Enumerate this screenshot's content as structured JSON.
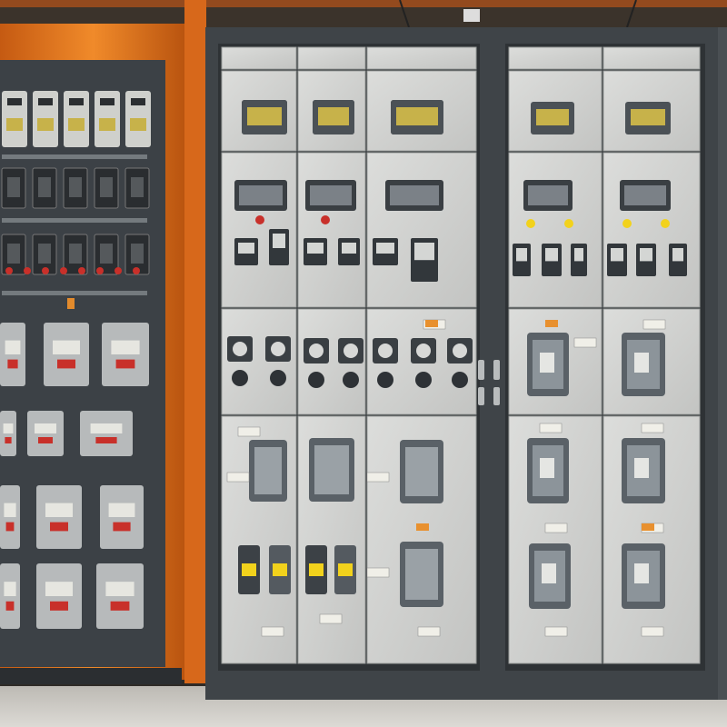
{
  "scene": {
    "subject": "",
    "colors": {
      "ceiling": "#3b332b",
      "orange_frame": "#e8731c",
      "dark_cabinet": "#3c4146",
      "grey_cabinet": "#3f4448",
      "panel_face": "#d5d6d4",
      "panel_face_alt": "#cfd0ce",
      "device_dark": "#545a60",
      "screen_yellow": "#c7b24a",
      "warning_yellow": "#f2d21c",
      "red_accent": "#c8302a",
      "floor": "#d3d1cc"
    }
  }
}
